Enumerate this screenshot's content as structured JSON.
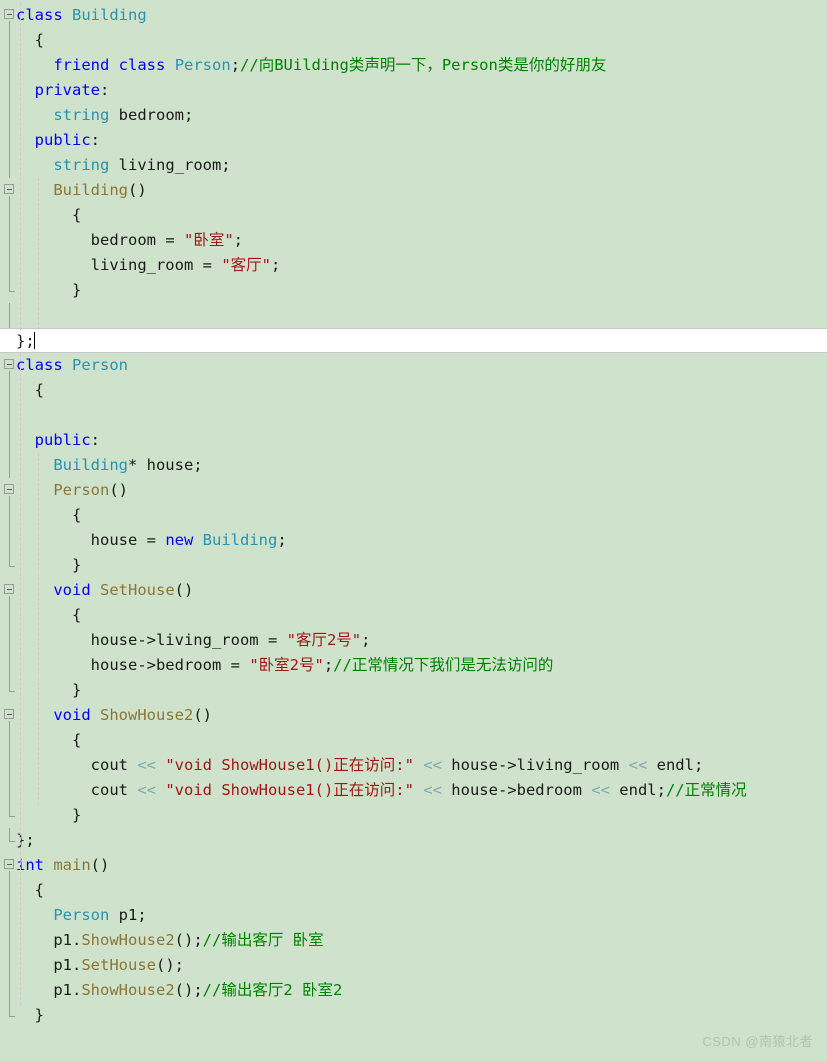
{
  "editor": {
    "background_color": "#CFE3CC",
    "current_line_background": "#FFFFFF",
    "language": "C++",
    "line_height": 25,
    "colors": {
      "keyword": "#0000FF",
      "type": "#2B91AF",
      "string": "#A31515",
      "comment": "#008000",
      "function": "#8B7536",
      "plain": "#1A1A1A",
      "operator": "#7FA9AE",
      "indent_guide": "#D9C7CD",
      "fold_line": "#9A9A9A"
    }
  },
  "watermark": {
    "text": "CSDN @南猿北者"
  },
  "lines": [
    {
      "n": 1,
      "indent": 0,
      "fold": "open",
      "tokens": [
        {
          "t": "class",
          "c": "kw"
        },
        {
          "t": " ",
          "c": "plain"
        },
        {
          "t": "Building",
          "c": "type"
        }
      ]
    },
    {
      "n": 2,
      "indent": 1,
      "fold": "bar",
      "tokens": [
        {
          "t": "{",
          "c": "punct"
        }
      ]
    },
    {
      "n": 3,
      "indent": 2,
      "fold": "bar",
      "tokens": [
        {
          "t": "friend",
          "c": "kw"
        },
        {
          "t": " ",
          "c": "plain"
        },
        {
          "t": "class",
          "c": "kw"
        },
        {
          "t": " ",
          "c": "plain"
        },
        {
          "t": "Person",
          "c": "type"
        },
        {
          "t": ";",
          "c": "punct"
        },
        {
          "t": "//向BUilding类声明一下，Person类是你的好朋友",
          "c": "cmt"
        }
      ]
    },
    {
      "n": 4,
      "indent": 1,
      "fold": "bar",
      "tokens": [
        {
          "t": "private",
          "c": "kw"
        },
        {
          "t": ":",
          "c": "punct"
        }
      ]
    },
    {
      "n": 5,
      "indent": 2,
      "fold": "bar",
      "tokens": [
        {
          "t": "string",
          "c": "type"
        },
        {
          "t": " bedroom;",
          "c": "plain"
        }
      ]
    },
    {
      "n": 6,
      "indent": 1,
      "fold": "bar",
      "tokens": [
        {
          "t": "public",
          "c": "kw"
        },
        {
          "t": ":",
          "c": "punct"
        }
      ]
    },
    {
      "n": 7,
      "indent": 2,
      "fold": "bar",
      "tokens": [
        {
          "t": "string",
          "c": "type"
        },
        {
          "t": " living_room;",
          "c": "plain"
        }
      ]
    },
    {
      "n": 8,
      "indent": 2,
      "fold": "open2",
      "tokens": [
        {
          "t": "Building",
          "c": "fn"
        },
        {
          "t": "()",
          "c": "punct"
        }
      ]
    },
    {
      "n": 9,
      "indent": 3,
      "fold": "bar2",
      "tokens": [
        {
          "t": "{",
          "c": "punct"
        }
      ]
    },
    {
      "n": 10,
      "indent": 4,
      "fold": "bar2",
      "tokens": [
        {
          "t": "bedroom ",
          "c": "plain"
        },
        {
          "t": "= ",
          "c": "punct"
        },
        {
          "t": "\"卧室\"",
          "c": "str"
        },
        {
          "t": ";",
          "c": "punct"
        }
      ]
    },
    {
      "n": 11,
      "indent": 4,
      "fold": "bar2",
      "tokens": [
        {
          "t": "living_room ",
          "c": "plain"
        },
        {
          "t": "= ",
          "c": "punct"
        },
        {
          "t": "\"客厅\"",
          "c": "str"
        },
        {
          "t": ";",
          "c": "punct"
        }
      ]
    },
    {
      "n": 12,
      "indent": 3,
      "fold": "end2",
      "tokens": [
        {
          "t": "}",
          "c": "punct"
        }
      ]
    },
    {
      "n": 13,
      "indent": 1,
      "fold": "bar",
      "tokens": []
    },
    {
      "n": 14,
      "indent": 0,
      "fold": "end",
      "tokens": [
        {
          "t": "};",
          "c": "punct"
        }
      ],
      "current": true
    },
    {
      "n": 15,
      "indent": 0,
      "fold": "open",
      "tokens": [
        {
          "t": "class",
          "c": "kw"
        },
        {
          "t": " ",
          "c": "plain"
        },
        {
          "t": "Person",
          "c": "type"
        }
      ]
    },
    {
      "n": 16,
      "indent": 1,
      "fold": "bar",
      "tokens": [
        {
          "t": "{",
          "c": "punct"
        }
      ]
    },
    {
      "n": 17,
      "indent": 1,
      "fold": "bar",
      "tokens": []
    },
    {
      "n": 18,
      "indent": 1,
      "fold": "bar",
      "tokens": [
        {
          "t": "public",
          "c": "kw"
        },
        {
          "t": ":",
          "c": "punct"
        }
      ]
    },
    {
      "n": 19,
      "indent": 2,
      "fold": "bar",
      "tokens": [
        {
          "t": "Building",
          "c": "type"
        },
        {
          "t": "* house;",
          "c": "plain"
        }
      ]
    },
    {
      "n": 20,
      "indent": 2,
      "fold": "open2",
      "tokens": [
        {
          "t": "Person",
          "c": "fn"
        },
        {
          "t": "()",
          "c": "punct"
        }
      ]
    },
    {
      "n": 21,
      "indent": 3,
      "fold": "bar2",
      "tokens": [
        {
          "t": "{",
          "c": "punct"
        }
      ]
    },
    {
      "n": 22,
      "indent": 4,
      "fold": "bar2",
      "tokens": [
        {
          "t": "house ",
          "c": "plain"
        },
        {
          "t": "= ",
          "c": "punct"
        },
        {
          "t": "new",
          "c": "kw"
        },
        {
          "t": " ",
          "c": "plain"
        },
        {
          "t": "Building",
          "c": "type"
        },
        {
          "t": ";",
          "c": "punct"
        }
      ]
    },
    {
      "n": 23,
      "indent": 3,
      "fold": "end2",
      "tokens": [
        {
          "t": "}",
          "c": "punct"
        }
      ]
    },
    {
      "n": 24,
      "indent": 2,
      "fold": "open2",
      "tokens": [
        {
          "t": "void",
          "c": "kw"
        },
        {
          "t": " ",
          "c": "plain"
        },
        {
          "t": "SetHouse",
          "c": "fn"
        },
        {
          "t": "()",
          "c": "punct"
        }
      ]
    },
    {
      "n": 25,
      "indent": 3,
      "fold": "bar2",
      "tokens": [
        {
          "t": "{",
          "c": "punct"
        }
      ]
    },
    {
      "n": 26,
      "indent": 4,
      "fold": "bar2",
      "tokens": [
        {
          "t": "house->living_room ",
          "c": "plain"
        },
        {
          "t": "= ",
          "c": "punct"
        },
        {
          "t": "\"客厅2号\"",
          "c": "str"
        },
        {
          "t": ";",
          "c": "punct"
        }
      ]
    },
    {
      "n": 27,
      "indent": 4,
      "fold": "bar2",
      "tokens": [
        {
          "t": "house->bedroom ",
          "c": "plain"
        },
        {
          "t": "= ",
          "c": "punct"
        },
        {
          "t": "\"卧室2号\"",
          "c": "str"
        },
        {
          "t": ";",
          "c": "punct"
        },
        {
          "t": "//正常情况下我们是无法访问的",
          "c": "cmt"
        }
      ]
    },
    {
      "n": 28,
      "indent": 3,
      "fold": "end2",
      "tokens": [
        {
          "t": "}",
          "c": "punct"
        }
      ]
    },
    {
      "n": 29,
      "indent": 2,
      "fold": "open2",
      "tokens": [
        {
          "t": "void",
          "c": "kw"
        },
        {
          "t": " ",
          "c": "plain"
        },
        {
          "t": "ShowHouse2",
          "c": "fn"
        },
        {
          "t": "()",
          "c": "punct"
        }
      ]
    },
    {
      "n": 30,
      "indent": 3,
      "fold": "bar2",
      "tokens": [
        {
          "t": "{",
          "c": "punct"
        }
      ]
    },
    {
      "n": 31,
      "indent": 4,
      "fold": "bar2",
      "tokens": [
        {
          "t": "cout ",
          "c": "plain"
        },
        {
          "t": "<< ",
          "c": "op"
        },
        {
          "t": "\"void ShowHouse1()正在访问:\"",
          "c": "str"
        },
        {
          "t": " << ",
          "c": "op"
        },
        {
          "t": "house->living_room",
          "c": "plain"
        },
        {
          "t": " << ",
          "c": "op"
        },
        {
          "t": "endl",
          "c": "plain"
        },
        {
          "t": ";",
          "c": "punct"
        }
      ]
    },
    {
      "n": 32,
      "indent": 4,
      "fold": "bar2",
      "tokens": [
        {
          "t": "cout ",
          "c": "plain"
        },
        {
          "t": "<< ",
          "c": "op"
        },
        {
          "t": "\"void ShowHouse1()正在访问:\"",
          "c": "str"
        },
        {
          "t": " << ",
          "c": "op"
        },
        {
          "t": "house->bedroom",
          "c": "plain"
        },
        {
          "t": " << ",
          "c": "op"
        },
        {
          "t": "endl",
          "c": "plain"
        },
        {
          "t": ";",
          "c": "punct"
        },
        {
          "t": "//正常情况",
          "c": "cmt"
        }
      ]
    },
    {
      "n": 33,
      "indent": 3,
      "fold": "end2",
      "tokens": [
        {
          "t": "}",
          "c": "punct"
        }
      ]
    },
    {
      "n": 34,
      "indent": 0,
      "fold": "end",
      "tokens": [
        {
          "t": "};",
          "c": "punct"
        }
      ]
    },
    {
      "n": 35,
      "indent": 0,
      "fold": "open",
      "tokens": [
        {
          "t": "int",
          "c": "kw"
        },
        {
          "t": " ",
          "c": "plain"
        },
        {
          "t": "main",
          "c": "fn"
        },
        {
          "t": "()",
          "c": "punct"
        }
      ]
    },
    {
      "n": 36,
      "indent": 1,
      "fold": "bar",
      "tokens": [
        {
          "t": "{",
          "c": "punct"
        }
      ]
    },
    {
      "n": 37,
      "indent": 2,
      "fold": "bar",
      "tokens": [
        {
          "t": "Person",
          "c": "type"
        },
        {
          "t": " p1;",
          "c": "plain"
        }
      ]
    },
    {
      "n": 38,
      "indent": 2,
      "fold": "bar",
      "tokens": [
        {
          "t": "p1.",
          "c": "plain"
        },
        {
          "t": "ShowHouse2",
          "c": "fn"
        },
        {
          "t": "();",
          "c": "punct"
        },
        {
          "t": "//输出客厅 卧室",
          "c": "cmt"
        }
      ]
    },
    {
      "n": 39,
      "indent": 2,
      "fold": "bar",
      "tokens": [
        {
          "t": "p1.",
          "c": "plain"
        },
        {
          "t": "SetHouse",
          "c": "fn"
        },
        {
          "t": "();",
          "c": "punct"
        }
      ]
    },
    {
      "n": 40,
      "indent": 2,
      "fold": "bar",
      "tokens": [
        {
          "t": "p1.",
          "c": "plain"
        },
        {
          "t": "ShowHouse2",
          "c": "fn"
        },
        {
          "t": "();",
          "c": "punct"
        },
        {
          "t": "//输出客厅2 卧室2",
          "c": "cmt"
        }
      ]
    },
    {
      "n": 41,
      "indent": 1,
      "fold": "end",
      "tokens": [
        {
          "t": "}",
          "c": "punct"
        }
      ]
    }
  ]
}
